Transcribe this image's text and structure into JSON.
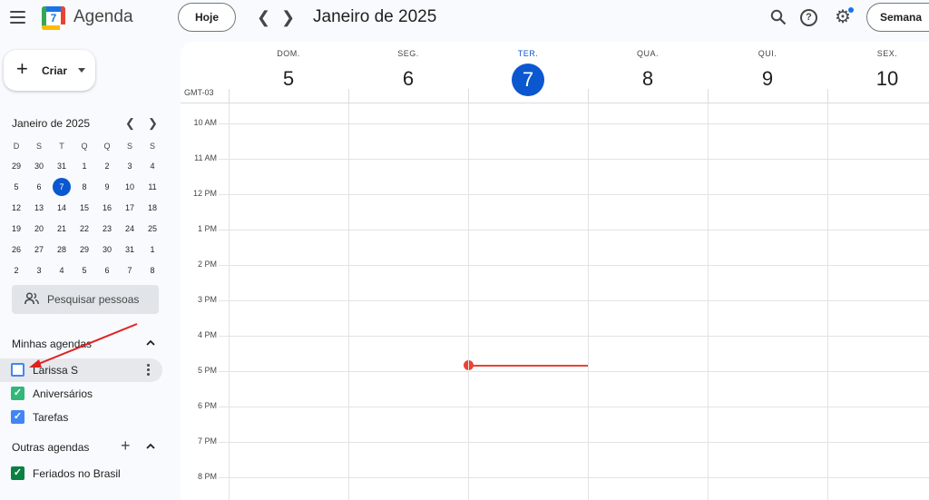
{
  "header": {
    "app_title": "Agenda",
    "logo_day": "7",
    "today_label": "Hoje",
    "date_title": "Janeiro de 2025",
    "view_label": "Semana",
    "icons": [
      "menu-icon",
      "search-icon",
      "help-icon",
      "settings-icon"
    ]
  },
  "sidebar": {
    "create_label": "Criar",
    "mini_calendar": {
      "title": "Janeiro de 2025",
      "weekdays": [
        "D",
        "S",
        "T",
        "Q",
        "Q",
        "S",
        "S"
      ],
      "weeks": [
        [
          "29",
          "30",
          "31",
          "1",
          "2",
          "3",
          "4"
        ],
        [
          "5",
          "6",
          "7",
          "8",
          "9",
          "10",
          "11"
        ],
        [
          "12",
          "13",
          "14",
          "15",
          "16",
          "17",
          "18"
        ],
        [
          "19",
          "20",
          "21",
          "22",
          "23",
          "24",
          "25"
        ],
        [
          "26",
          "27",
          "28",
          "29",
          "30",
          "31",
          "1"
        ],
        [
          "2",
          "3",
          "4",
          "5",
          "6",
          "7",
          "8"
        ]
      ],
      "today": "7"
    },
    "search_people": "Pesquisar pessoas",
    "my_calendars": {
      "title": "Minhas agendas",
      "items": [
        {
          "label": "Larissa S",
          "checked": false,
          "color": "#4285f4"
        },
        {
          "label": "Aniversários",
          "checked": true,
          "color": "#33b679"
        },
        {
          "label": "Tarefas",
          "checked": true,
          "color": "#4285f4"
        }
      ]
    },
    "other_calendars": {
      "title": "Outras agendas",
      "items": [
        {
          "label": "Feriados no Brasil",
          "checked": true,
          "color": "#0b8043"
        }
      ]
    }
  },
  "week": {
    "timezone": "GMT-03",
    "days": [
      {
        "name": "DOM.",
        "num": "5"
      },
      {
        "name": "SEG.",
        "num": "6"
      },
      {
        "name": "TER.",
        "num": "7",
        "today": true
      },
      {
        "name": "QUA.",
        "num": "8"
      },
      {
        "name": "QUI.",
        "num": "9"
      },
      {
        "name": "SEX.",
        "num": "10"
      }
    ],
    "hours": [
      "10 AM",
      "11 AM",
      "12 PM",
      "1 PM",
      "2 PM",
      "3 PM",
      "4 PM",
      "5 PM",
      "6 PM",
      "7 PM",
      "8 PM"
    ]
  },
  "colors": {
    "accent": "#0b57d0",
    "now_indicator": "#ea4335"
  }
}
